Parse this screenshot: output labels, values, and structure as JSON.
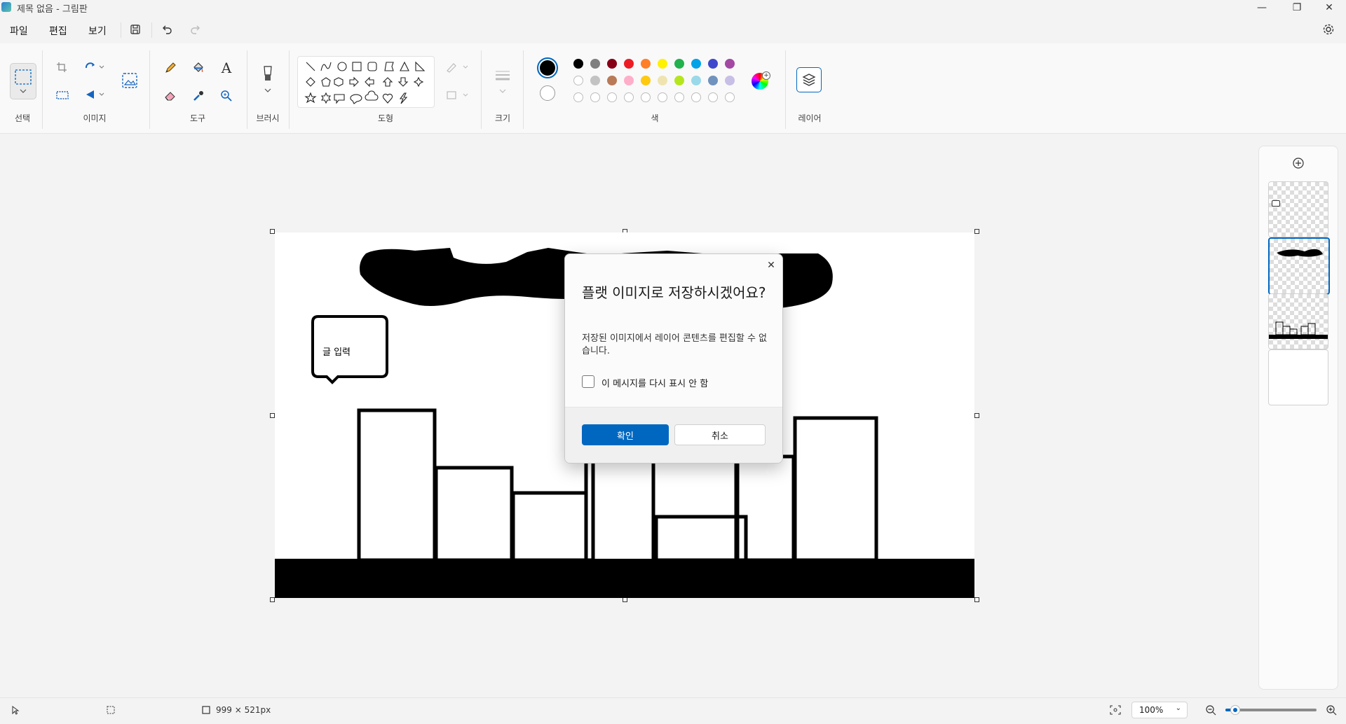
{
  "window": {
    "title": "제목 없음 - 그림판"
  },
  "menu": {
    "file": "파일",
    "edit": "편집",
    "view": "보기"
  },
  "ribbon": {
    "groups": {
      "select": "선택",
      "image": "이미지",
      "tools": "도구",
      "brushes": "브러시",
      "shapes": "도형",
      "size": "크기",
      "colors": "색",
      "layers": "레이어"
    },
    "colors": {
      "primary": "#000000",
      "secondary": "#ffffff",
      "row1": [
        "#000000",
        "#7f7f7f",
        "#880015",
        "#ed1c24",
        "#ff7f27",
        "#fff200",
        "#22b14c",
        "#00a2e8",
        "#3f48cc",
        "#a349a4"
      ],
      "row2": [
        "#ffffff",
        "#c3c3c3",
        "#b97a57",
        "#ffaec9",
        "#ffc90e",
        "#efe4b0",
        "#b5e61d",
        "#99d9ea",
        "#7092be",
        "#c8bfe7"
      ]
    },
    "shape_icons": [
      "line-icon",
      "curve-icon",
      "oval-icon",
      "rectangle-icon",
      "rounded-rectangle-icon",
      "polygon-icon",
      "triangle-icon",
      "right-triangle-icon",
      "diamond-icon",
      "pentagon-icon",
      "hexagon-icon",
      "right-arrow-icon",
      "left-arrow-icon",
      "up-arrow-icon",
      "down-arrow-icon",
      "four-point-star-icon",
      "five-point-star-icon",
      "six-point-star-icon",
      "rounded-callout-icon",
      "oval-callout-icon",
      "cloud-callout-icon",
      "heart-icon",
      "lightning-icon"
    ]
  },
  "canvas": {
    "speech_bubble_text": "글 입력"
  },
  "dialog": {
    "title": "플랫 이미지로 저장하시겠어요?",
    "message": "저장된 이미지에서 레이어 콘텐츠를 편집할 수 없습니다.",
    "checkbox_label": "이 메시지를 다시 표시 안 함",
    "checkbox_checked": false,
    "ok_label": "확인",
    "cancel_label": "취소",
    "accent": "#0067c0"
  },
  "status": {
    "canvas_size": "999 × 521px",
    "zoom": "100%"
  }
}
